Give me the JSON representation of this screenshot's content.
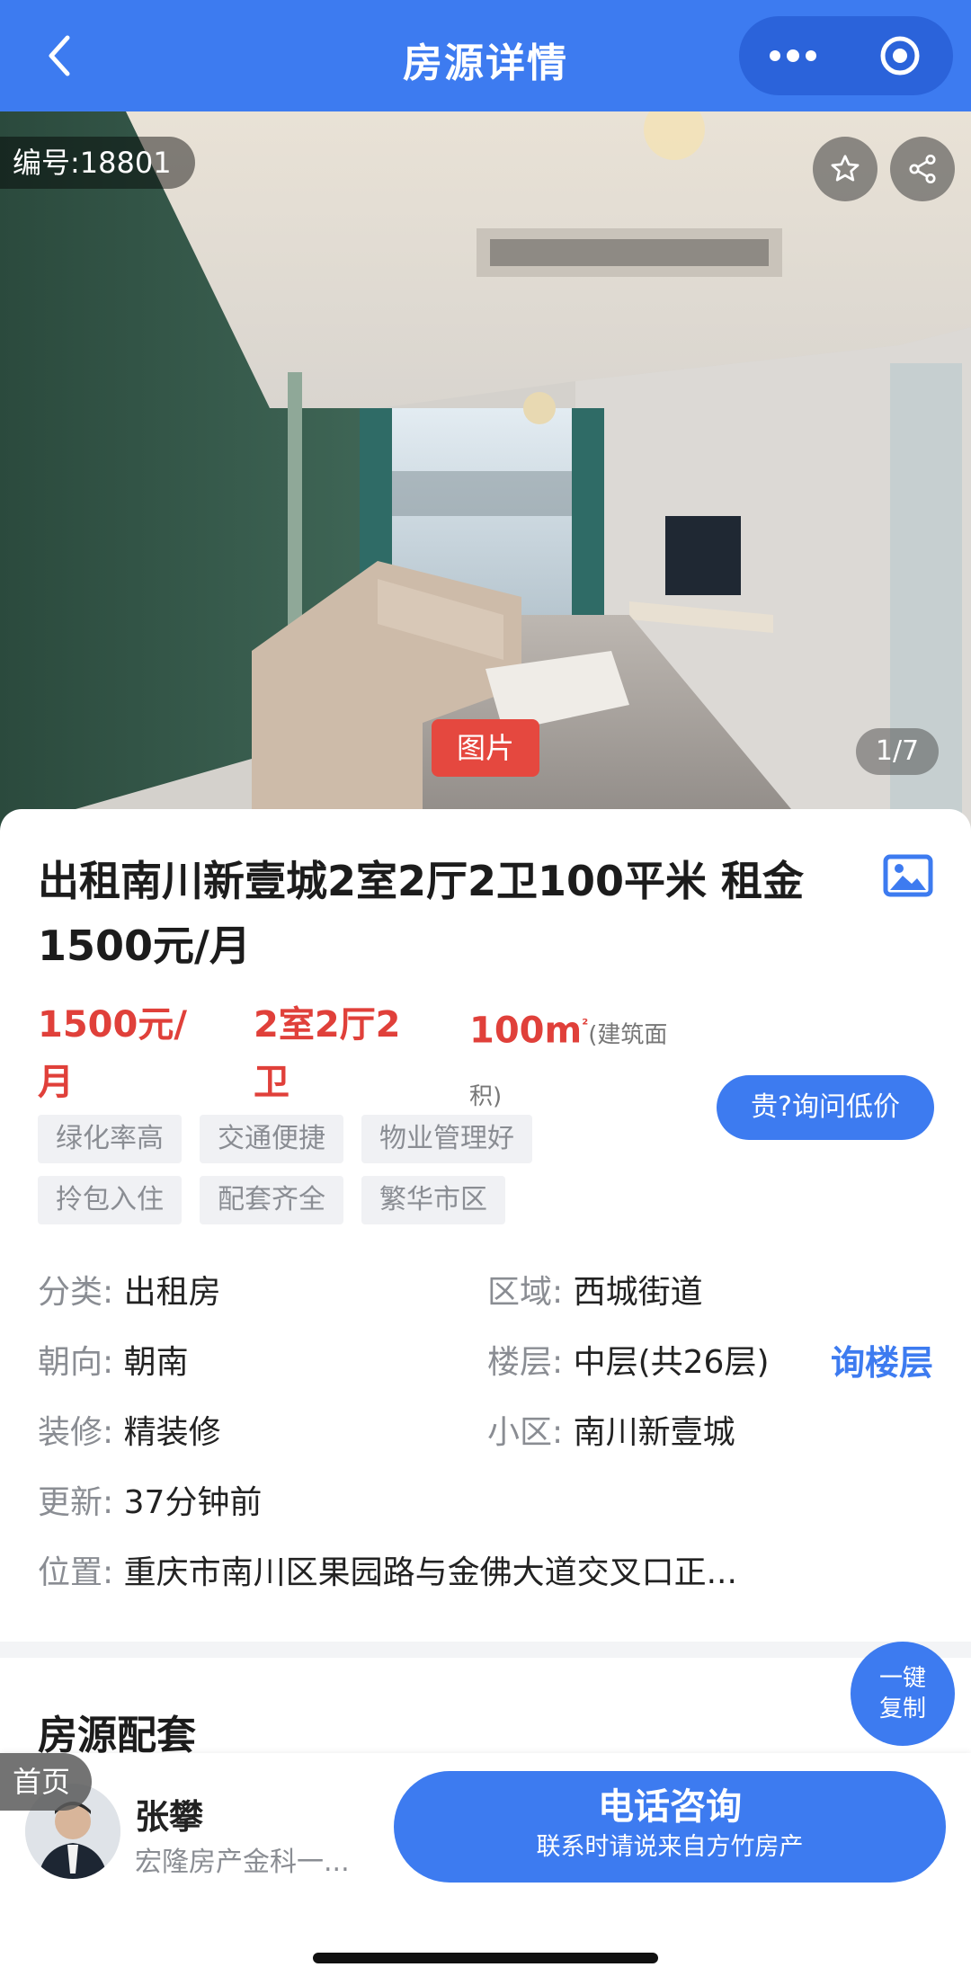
{
  "nav": {
    "title": "房源详情",
    "back_icon": "chevron-left-icon",
    "more_icon": "more-dots-icon",
    "target_icon": "target-circle-icon"
  },
  "hero": {
    "listing_id": "编号:18801",
    "photo_tag": "图片",
    "counter": "1/7",
    "star_icon": "star-icon",
    "share_icon": "share-icon"
  },
  "listing": {
    "title": "出租南川新壹城2室2厅2卫100平米 租金1500元/月",
    "price": "1500元/月",
    "layout": "2室2厅2卫",
    "area": "100m",
    "area_unit_sup": "²",
    "area_note": "(建筑面积)",
    "ask_button": "贵?询问低价",
    "tags": [
      "绿化率高",
      "交通便捷",
      "物业管理好",
      "拎包入住",
      "配套齐全",
      "繁华市区"
    ]
  },
  "details": {
    "category": {
      "label": "分类:",
      "value": "出租房"
    },
    "region": {
      "label": "区域:",
      "value": "西城街道"
    },
    "orientation": {
      "label": "朝向:",
      "value": "朝南"
    },
    "floor": {
      "label": "楼层:",
      "value": "中层(共26层)"
    },
    "ask_floor": "询楼层",
    "decoration": {
      "label": "装修:",
      "value": "精装修"
    },
    "community": {
      "label": "小区:",
      "value": "南川新壹城"
    },
    "updated": {
      "label": "更新:",
      "value": "37分钟前"
    },
    "location": {
      "label": "位置:",
      "value": "重庆市南川区果园路与金佛大道交叉口正..."
    }
  },
  "section": {
    "title": "房源配套",
    "copy_button_line1": "一键",
    "copy_button_line2": "复制"
  },
  "bottom": {
    "home_tag": "首页",
    "agent_name": "张攀",
    "agent_company": "宏隆房产金科一...",
    "call_main": "电话咨询",
    "call_sub": "联系时请说来自方竹房产"
  },
  "colors": {
    "brand_blue": "#3d7bf0",
    "price_red": "#e0403a",
    "tag_bg": "#f0f1f4"
  }
}
